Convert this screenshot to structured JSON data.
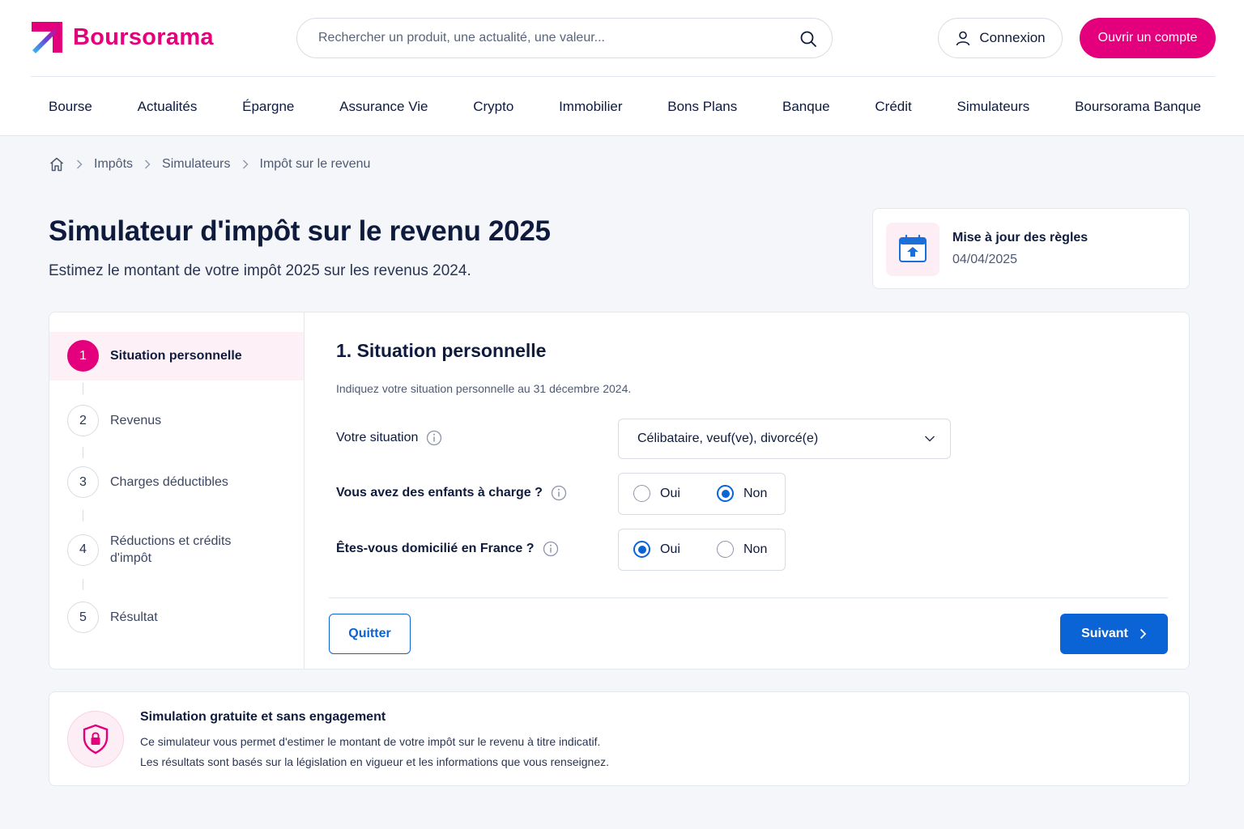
{
  "header": {
    "logo_text": "Boursorama",
    "search_placeholder": "Rechercher un produit, une actualité, une valeur...",
    "login_label": "Connexion",
    "open_account_label": "Ouvrir un compte",
    "brand_color": "#e4007c"
  },
  "nav": {
    "items": [
      "Bourse",
      "Actualités",
      "Épargne",
      "Assurance Vie",
      "Crypto",
      "Immobilier",
      "Bons Plans",
      "Banque",
      "Crédit",
      "Simulateurs",
      "Boursorama Banque"
    ]
  },
  "breadcrumb": {
    "items": [
      "Impôts",
      "Simulateurs",
      "Impôt sur le revenu"
    ]
  },
  "page": {
    "title": "Simulateur d'impôt sur le revenu 2025",
    "subtitle": "Estimez le montant de votre impôt 2025 sur les revenus 2024."
  },
  "update_card": {
    "title": "Mise à jour des règles",
    "date": "04/04/2025"
  },
  "steps": [
    {
      "num": "1",
      "label": "Situation personnelle",
      "active": true
    },
    {
      "num": "2",
      "label": "Revenus",
      "active": false
    },
    {
      "num": "3",
      "label": "Charges déductibles",
      "active": false
    },
    {
      "num": "4",
      "label": "Réductions et crédits d'impôt",
      "active": false
    },
    {
      "num": "5",
      "label": "Résultat",
      "active": false
    }
  ],
  "form": {
    "title": "1. Situation personnelle",
    "hint": "Indiquez votre situation personnelle au 31 décembre 2024.",
    "situation": {
      "label": "Votre situation",
      "value": "Célibataire, veuf(ve), divorcé(e)"
    },
    "children": {
      "label": "Vous avez des enfants à charge ?",
      "option_yes": "Oui",
      "option_no": "Non",
      "selected": "Non"
    },
    "domicile": {
      "label": "Êtes-vous domicilié en France ?",
      "option_yes": "Oui",
      "option_no": "Non",
      "selected": "Oui"
    },
    "quit_label": "Quitter",
    "next_label": "Suivant",
    "accent_color": "#0a64d6"
  },
  "info_card": {
    "title": "Simulation gratuite et sans engagement",
    "line1": "Ce simulateur vous permet d'estimer le montant de votre impôt sur le revenu à titre indicatif.",
    "line2": "Les résultats sont basés sur la législation en vigueur et les informations que vous renseignez."
  }
}
